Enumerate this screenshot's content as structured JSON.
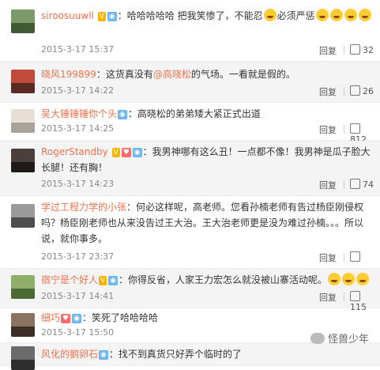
{
  "comments": [
    {
      "user": "siroosuuwll",
      "text": "：哈哈哈哈哈 把我笑惨了，不能忍",
      "text2": "必须严惩",
      "time": "2015-3-17 15:37",
      "reply": "回复",
      "likes": "32",
      "emoji_after_text": 1,
      "emoji_trailing": 4
    },
    {
      "user": "晓风199899",
      "text_pre": "：这货真没有",
      "mention": "@高晓松",
      "text_post": "的气场。一看就是假的。",
      "time": "2015-3-17 14:22",
      "reply": "回复",
      "likes": "26"
    },
    {
      "user": "吴大锤锤锤你个头",
      "text": "：高晓松的弟弟矮大紧正式出道",
      "time": "2015-3-17 14:25",
      "reply": "回复",
      "likes": "812"
    },
    {
      "user": "RogerStandby",
      "text": "：我男神哪有这么丑！一点都不像！我男神是瓜子脸大长腿！还有胸！",
      "time": "2015-3-17 14:23",
      "reply": "回复",
      "likes": "74"
    },
    {
      "user": "学过工程力学的小张",
      "text": "：何必这样呢，高老师。您看孙楠老师有告过杨臣刚侵权吗？杨臣刚老师也从来没告过王大治。王大治老师更是没为难过孙楠。。。所以说，就你事多。",
      "time": "2015-3-17 23:37",
      "reply": "回复",
      "likes": ""
    },
    {
      "user": "宿宁是个好人",
      "text": "：你得反省，人家王力宏怎么就没被山寨活动呢。",
      "time": "2015-3-17 14:41",
      "reply": "回复",
      "likes": "115"
    },
    {
      "user": "细巧",
      "text": "：笑死了哈哈哈哈",
      "time": "2015-3-17 15:50",
      "reply": "",
      "likes": ""
    },
    {
      "user": "风化的鹅卵石",
      "text": "：找不到真货只好弄个临时的了",
      "time": "",
      "reply": "",
      "likes": ""
    }
  ],
  "watermark": "怪兽少年",
  "badges": {
    "v": "V",
    "heart": "♥",
    "bulb": "◉"
  },
  "colors": {
    "username": "#eb7350",
    "text": "#333333",
    "meta": "#888888"
  }
}
